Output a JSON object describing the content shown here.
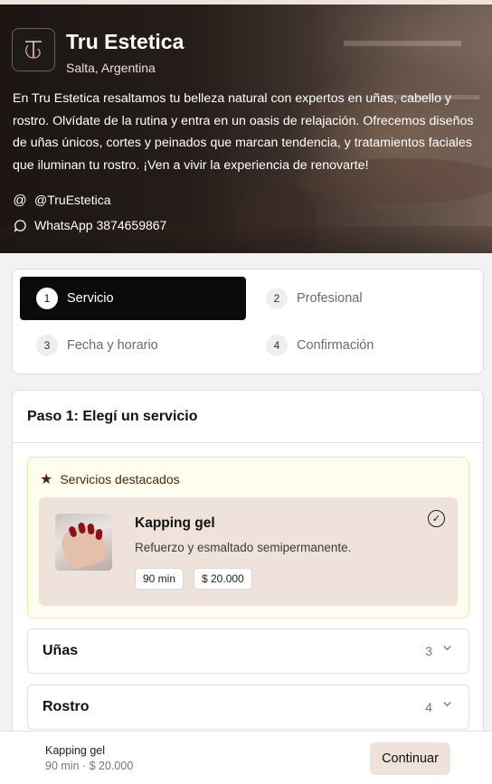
{
  "hero": {
    "brand_name": "Tru Estetica",
    "location": "Salta, Argentina",
    "description": "En Tru Estetica resaltamos tu belleza natural con expertos en uñas, cabello y rostro. Olvídate de la rutina y entra en un oasis de relajación. Ofrecemos diseños de uñas únicos, cortes y peinados que marcan tendencia, y tratamientos faciales que iluminan tu rostro. ¡Ven a vivir la experiencia de renovarte!",
    "instagram": "@TruEstetica",
    "whatsapp": "WhatsApp 3874659867",
    "logo_icon": "tru-estetica-logo",
    "at_icon": "at-icon",
    "whatsapp_icon": "chat-bubble-icon"
  },
  "steps": [
    {
      "num": "1",
      "label": "Servicio",
      "active": true
    },
    {
      "num": "2",
      "label": "Profesional",
      "active": false
    },
    {
      "num": "3",
      "label": "Fecha y horario",
      "active": false
    },
    {
      "num": "4",
      "label": "Confirmación",
      "active": false
    }
  ],
  "card": {
    "title": "Paso 1: Elegí un servicio",
    "featured": {
      "heading": "Servicios destacados",
      "icon": "star-icon",
      "service": {
        "name": "Kapping gel",
        "description": "Refuerzo y esmaltado semipermanente.",
        "duration": "90 min",
        "price": "$ 20.000",
        "selected": true
      }
    },
    "categories": [
      {
        "name": "Uñas",
        "count": "3"
      },
      {
        "name": "Rostro",
        "count": "4"
      }
    ]
  },
  "footer": {
    "service_name": "Kapping gel",
    "meta": "90 min · $ 20.000",
    "continue_label": "Continuar"
  },
  "colors": {
    "active_step_bg": "#0b0b0b",
    "accent_soft": "#efe2db",
    "featured_bg": "#fffcf0",
    "featured_border": "#f2e5a8"
  }
}
